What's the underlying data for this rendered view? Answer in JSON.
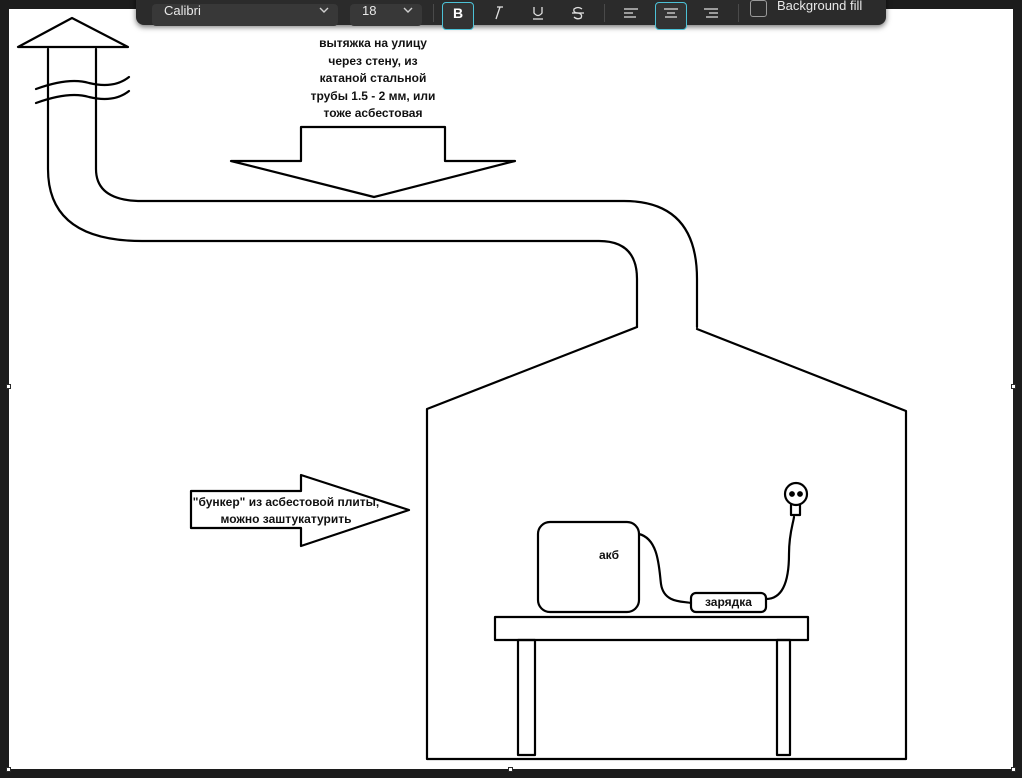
{
  "toolbar": {
    "font_family_value": "Calibri",
    "font_size_value": "18",
    "bold_icon": "bold-icon",
    "italic_icon": "italic-icon",
    "underline_icon": "underline-icon",
    "strikethrough_icon": "strikethrough-icon",
    "align_left_icon": "align-left-icon",
    "align_center_icon": "align-center-icon",
    "align_right_icon": "align-right-icon",
    "background_fill_label": "Background fill",
    "accent_color": "#4cc2d7"
  },
  "drawing": {
    "exhaust_note": "вытяжка на улицу\nчерез стену, из\nкатаной стальной\nтрубы 1.5 - 2 мм, или\nтоже асбестовая",
    "bunker_note": "\"бункер\" из асбестовой плиты,\nможно заштукатурить",
    "battery_label": "акб",
    "charger_label": "зарядка"
  }
}
